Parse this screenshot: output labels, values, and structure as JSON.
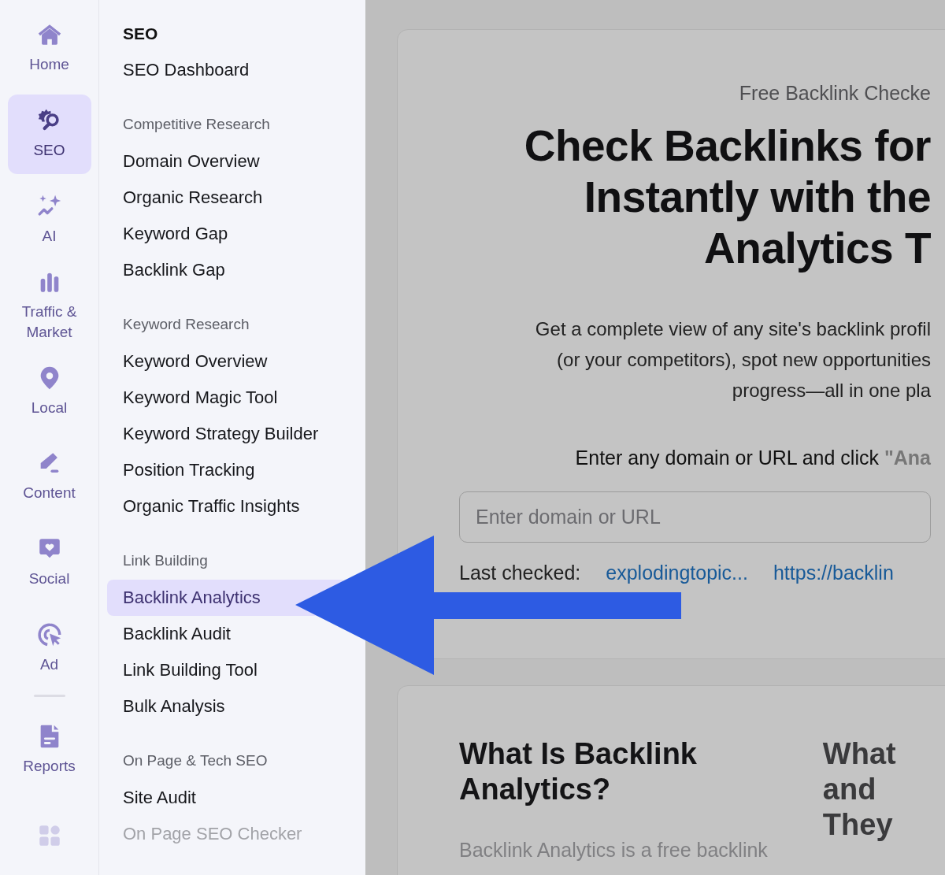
{
  "rail": [
    {
      "kind": "home",
      "label": "Home",
      "selected": false
    },
    {
      "kind": "seo",
      "label": "SEO",
      "selected": true
    },
    {
      "kind": "ai",
      "label": "AI",
      "selected": false
    },
    {
      "kind": "chart",
      "label": "Traffic & Market",
      "selected": false
    },
    {
      "kind": "pin",
      "label": "Local",
      "selected": false
    },
    {
      "kind": "pen",
      "label": "Content",
      "selected": false
    },
    {
      "kind": "heart",
      "label": "Social",
      "selected": false
    },
    {
      "kind": "target",
      "label": "Ad",
      "selected": false
    },
    {
      "kind": "divider"
    },
    {
      "kind": "report",
      "label": "Reports",
      "selected": false
    },
    {
      "kind": "apps",
      "faded": true
    }
  ],
  "menu": {
    "title": "SEO",
    "top_items": [
      {
        "label": "SEO Dashboard",
        "selected": false,
        "faded": false
      }
    ],
    "sections": [
      {
        "heading": "Competitive Research",
        "items": [
          {
            "label": "Domain Overview",
            "selected": false,
            "faded": false
          },
          {
            "label": "Organic Research",
            "selected": false,
            "faded": false
          },
          {
            "label": "Keyword Gap",
            "selected": false,
            "faded": false
          },
          {
            "label": "Backlink Gap",
            "selected": false,
            "faded": false
          }
        ]
      },
      {
        "heading": "Keyword Research",
        "items": [
          {
            "label": "Keyword Overview",
            "selected": false,
            "faded": false
          },
          {
            "label": "Keyword Magic Tool",
            "selected": false,
            "faded": false
          },
          {
            "label": "Keyword Strategy Builder",
            "selected": false,
            "faded": false
          },
          {
            "label": "Position Tracking",
            "selected": false,
            "faded": false
          },
          {
            "label": "Organic Traffic Insights",
            "selected": false,
            "faded": false
          }
        ]
      },
      {
        "heading": "Link Building",
        "items": [
          {
            "label": "Backlink Analytics",
            "selected": true,
            "faded": false
          },
          {
            "label": "Backlink Audit",
            "selected": false,
            "faded": false
          },
          {
            "label": "Link Building Tool",
            "selected": false,
            "faded": false
          },
          {
            "label": "Bulk Analysis",
            "selected": false,
            "faded": false
          }
        ]
      },
      {
        "heading": "On Page & Tech SEO",
        "items": [
          {
            "label": "Site Audit",
            "selected": false,
            "faded": false
          },
          {
            "label": "On Page SEO Checker",
            "selected": false,
            "faded": true
          }
        ]
      }
    ]
  },
  "hero_card": {
    "eyebrow": "Free Backlink Checke",
    "title_lines": [
      "Check Backlinks for",
      "Instantly with the",
      "Analytics T"
    ],
    "description_lines": [
      "Get a complete view of any site's backlink profil",
      "(or your competitors), spot new opportunities",
      "progress—all in one pla"
    ],
    "instruction": "Enter any domain or URL and click **\"Ana**",
    "search": {
      "placeholder": "Enter domain or URL"
    },
    "last_checked": {
      "label": "Last checked:",
      "links": [
        "explodingtopic...",
        "https://backlin"
      ]
    }
  },
  "info_card": {
    "title_lines": [
      "What Is Backlink",
      "Analytics?"
    ],
    "body": "Backlink Analytics is a free backlink",
    "side_title_lines": [
      "What",
      "and",
      "They"
    ]
  },
  "annotation": {
    "kind": "arrow"
  }
}
